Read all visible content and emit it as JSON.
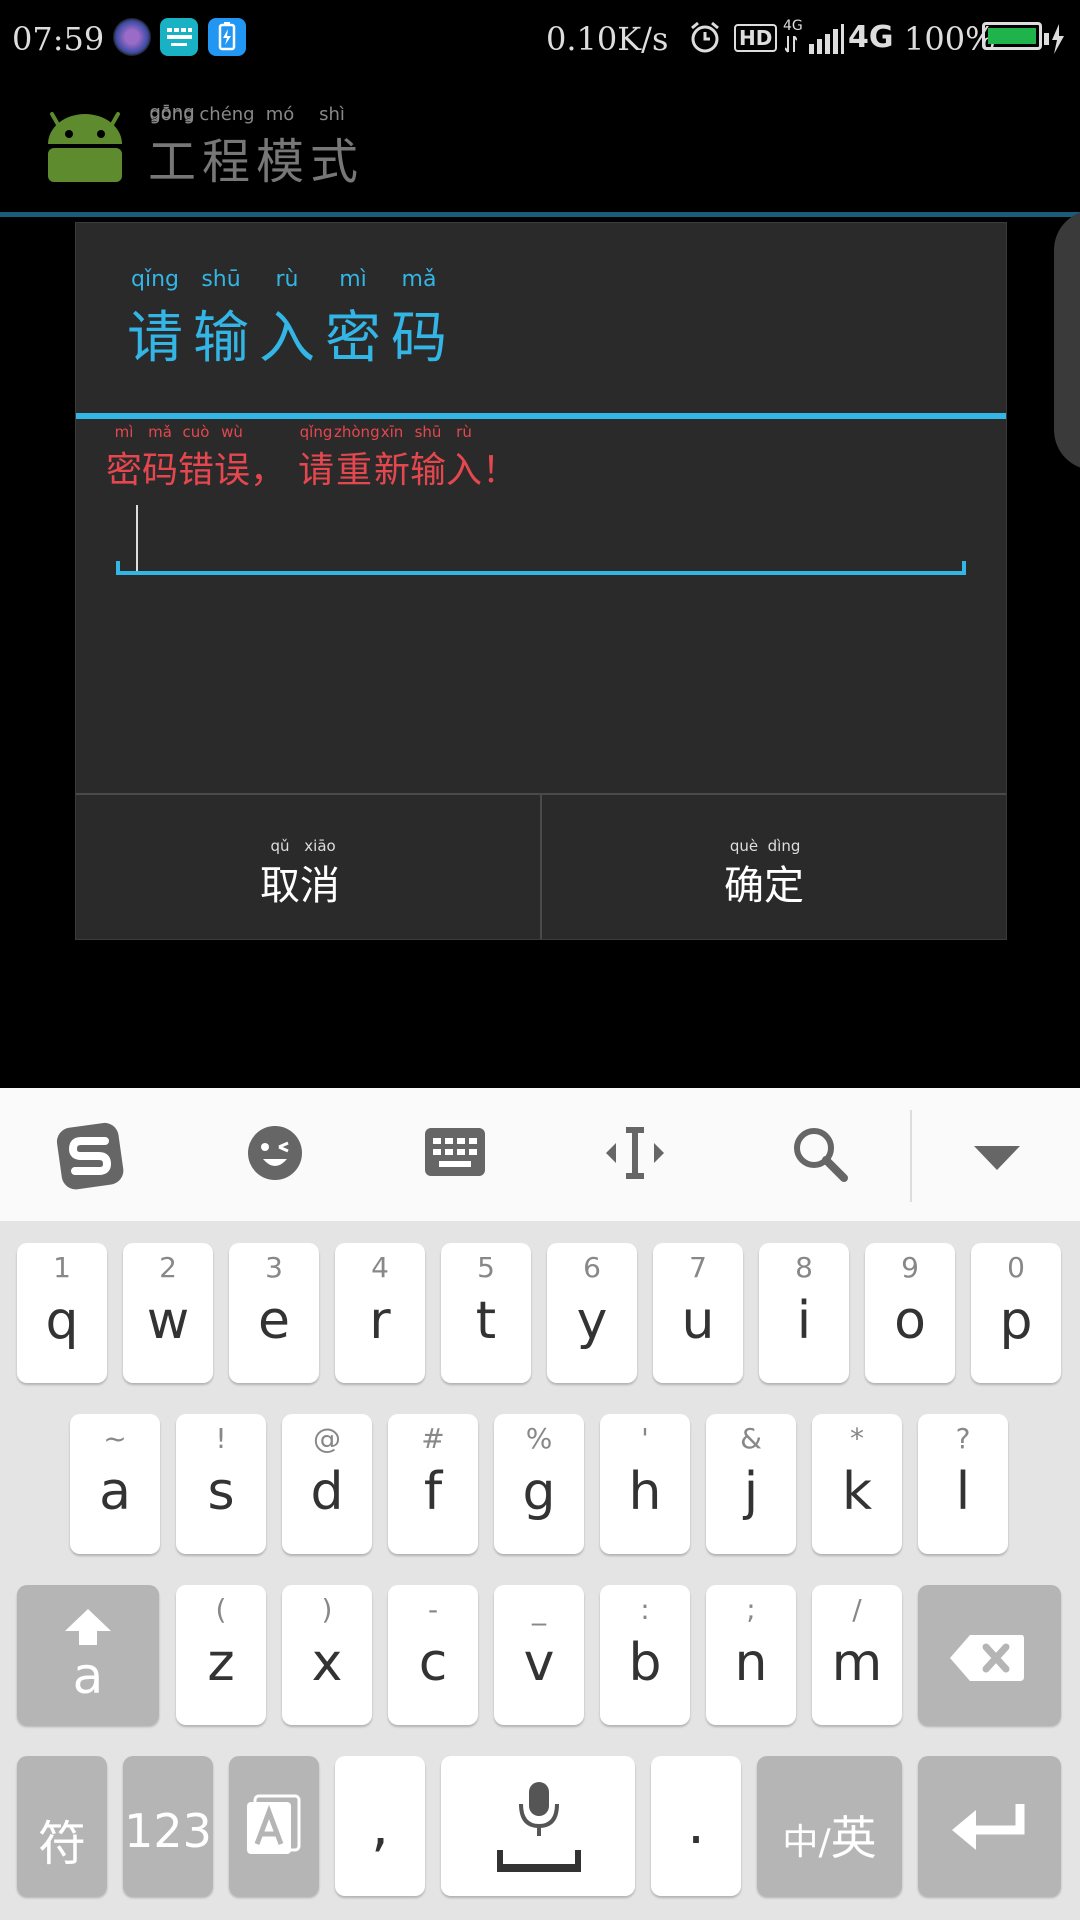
{
  "status_bar": {
    "time": "07:59",
    "net_speed": "0.10K/s",
    "hd": "HD",
    "net_small": "4G",
    "network": "4G",
    "battery": "100%"
  },
  "action_bar": {
    "title_pinyin": [
      "gōng",
      "chéng",
      "mó",
      "shì"
    ],
    "title_chars": [
      "工",
      "程",
      "模",
      "式"
    ]
  },
  "dialog": {
    "title_pinyin": [
      "qǐng",
      "shū",
      "rù",
      "mì",
      "mǎ"
    ],
    "title_chars": [
      "请",
      "输",
      "入",
      "密",
      "码"
    ],
    "error_pinyin": [
      "mì",
      "mǎ",
      "cuò",
      "wù",
      "qǐng",
      "zhòng",
      "xīn",
      "shū",
      "rù"
    ],
    "error_chars": [
      "密",
      "码",
      "错",
      "误",
      "，",
      "请",
      "重",
      "新",
      "输",
      "入",
      "！"
    ],
    "password_value": "",
    "cancel": {
      "pinyin": [
        "qǔ",
        "xiāo"
      ],
      "chars": [
        "取",
        "消"
      ]
    },
    "confirm": {
      "pinyin": [
        "què",
        "dìng"
      ],
      "chars": [
        "确",
        "定"
      ]
    }
  },
  "keyboard": {
    "row1": [
      {
        "main": "q",
        "sub": "1"
      },
      {
        "main": "w",
        "sub": "2"
      },
      {
        "main": "e",
        "sub": "3"
      },
      {
        "main": "r",
        "sub": "4"
      },
      {
        "main": "t",
        "sub": "5"
      },
      {
        "main": "y",
        "sub": "6"
      },
      {
        "main": "u",
        "sub": "7"
      },
      {
        "main": "i",
        "sub": "8"
      },
      {
        "main": "o",
        "sub": "9"
      },
      {
        "main": "p",
        "sub": "0"
      }
    ],
    "row2": [
      {
        "main": "a",
        "sub": "~"
      },
      {
        "main": "s",
        "sub": "!"
      },
      {
        "main": "d",
        "sub": "@"
      },
      {
        "main": "f",
        "sub": "#"
      },
      {
        "main": "g",
        "sub": "%"
      },
      {
        "main": "h",
        "sub": "'"
      },
      {
        "main": "j",
        "sub": "&"
      },
      {
        "main": "k",
        "sub": "*"
      },
      {
        "main": "l",
        "sub": "?"
      }
    ],
    "row3": [
      {
        "main": "z",
        "sub": "("
      },
      {
        "main": "x",
        "sub": ")"
      },
      {
        "main": "c",
        "sub": "-"
      },
      {
        "main": "v",
        "sub": "_"
      },
      {
        "main": "b",
        "sub": ":"
      },
      {
        "main": "n",
        "sub": ";"
      },
      {
        "main": "m",
        "sub": "/"
      }
    ],
    "shift_label": "a",
    "symbol_label": "符",
    "numbers_label": "123",
    "comma_label": ",",
    "period_label": ".",
    "lang_zh": "中",
    "lang_sep": "/",
    "lang_en": "英",
    "toolbar_icons": [
      "sogou-logo-icon",
      "emoji-icon",
      "keyboard-icon",
      "cursor-move-icon",
      "search-icon",
      "collapse-icon"
    ]
  },
  "colors": {
    "accent": "#33b5e5",
    "error": "#e5474f",
    "divider": "#1b5c7c"
  }
}
